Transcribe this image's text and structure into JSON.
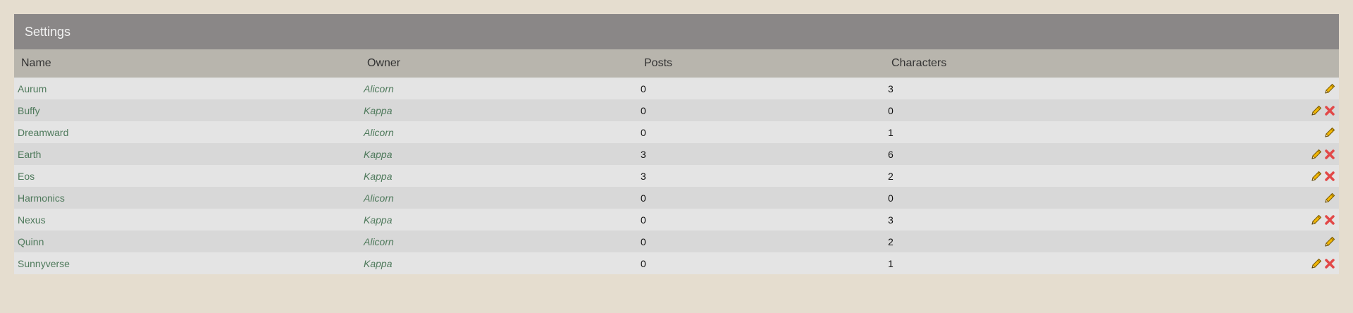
{
  "panel": {
    "title": "Settings"
  },
  "columns": {
    "name": "Name",
    "owner": "Owner",
    "posts": "Posts",
    "characters": "Characters"
  },
  "colors": {
    "background": "#e5ddcf",
    "header": "#8a8787",
    "link": "#4f7a5c",
    "delete": "#e04040",
    "edit": "#f0b400"
  },
  "rows": [
    {
      "name": "Aurum",
      "owner": "Alicorn",
      "posts": "0",
      "characters": "3",
      "actions": [
        "edit-icon"
      ]
    },
    {
      "name": "Buffy",
      "owner": "Kappa",
      "posts": "0",
      "characters": "0",
      "actions": [
        "edit-icon",
        "delete-icon"
      ]
    },
    {
      "name": "Dreamward",
      "owner": "Alicorn",
      "posts": "0",
      "characters": "1",
      "actions": [
        "edit-icon"
      ]
    },
    {
      "name": "Earth",
      "owner": "Kappa",
      "posts": "3",
      "characters": "6",
      "actions": [
        "edit-icon",
        "delete-icon"
      ]
    },
    {
      "name": "Eos",
      "owner": "Kappa",
      "posts": "3",
      "characters": "2",
      "actions": [
        "edit-icon",
        "delete-icon"
      ]
    },
    {
      "name": "Harmonics",
      "owner": "Alicorn",
      "posts": "0",
      "characters": "0",
      "actions": [
        "edit-icon"
      ]
    },
    {
      "name": "Nexus",
      "owner": "Kappa",
      "posts": "0",
      "characters": "3",
      "actions": [
        "edit-icon",
        "delete-icon"
      ]
    },
    {
      "name": "Quinn",
      "owner": "Alicorn",
      "posts": "0",
      "characters": "2",
      "actions": [
        "edit-icon"
      ]
    },
    {
      "name": "Sunnyverse",
      "owner": "Kappa",
      "posts": "0",
      "characters": "1",
      "actions": [
        "edit-icon",
        "delete-icon"
      ]
    }
  ]
}
